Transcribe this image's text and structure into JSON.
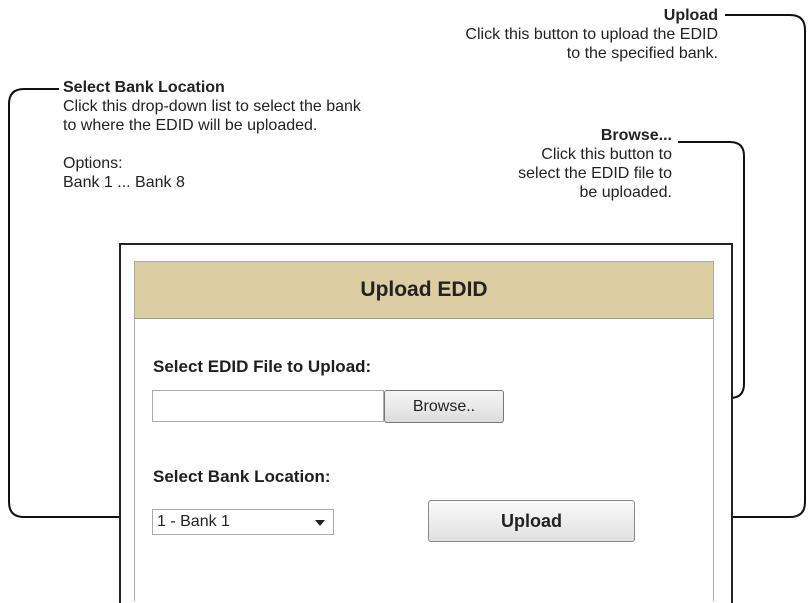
{
  "callouts": {
    "upload": {
      "title": "Upload",
      "line1": "Click this button to upload the EDID",
      "line2": "to the specified bank."
    },
    "bank": {
      "title": "Select Bank Location",
      "line1": "Click this drop-down list to select the bank",
      "line2": "to where the EDID will be uploaded.",
      "options_label": "Options:",
      "options_value": "Bank 1 ... Bank 8"
    },
    "browse": {
      "title": "Browse...",
      "line1": "Click this button to",
      "line2": "select the EDID file to",
      "line3": "be uploaded."
    }
  },
  "panel": {
    "header": "Upload EDID",
    "file_label": "Select EDID File to Upload:",
    "file_value": "",
    "browse_label": "Browse..",
    "bank_label": "Select Bank Location:",
    "bank_selected": "1 - Bank 1",
    "upload_label": "Upload",
    "header_color": "#dccda3"
  }
}
